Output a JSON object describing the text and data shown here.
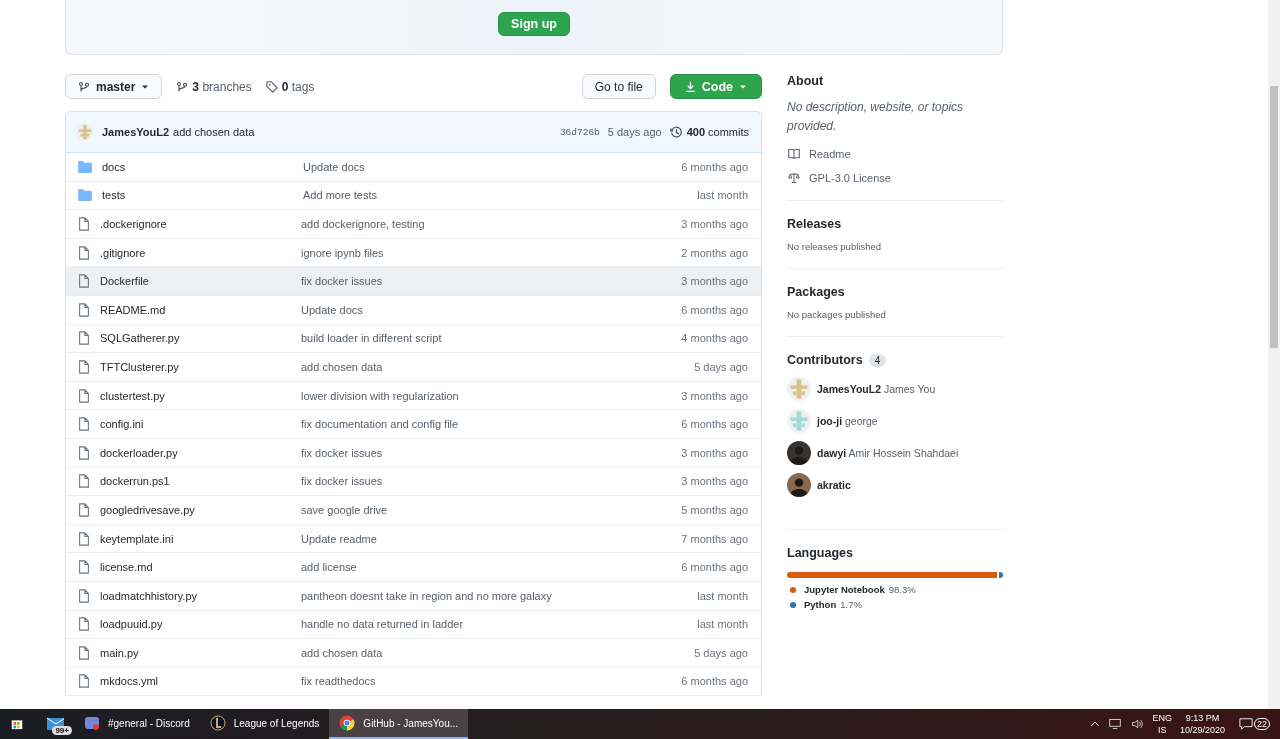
{
  "banner": {
    "button": "Sign up"
  },
  "branch_bar": {
    "branch": "master",
    "branches": "**3** branches",
    "tags": "**0** tags",
    "go_to_file": "Go to file",
    "code_button": "Code"
  },
  "latest_commit": {
    "author": "JamesYouL2",
    "message": "add chosen data",
    "sha": "36d726b",
    "time": "5 days ago",
    "commits": "**400** commits",
    "avatar": {
      "kind": "identicon",
      "color": "#d8c48a"
    }
  },
  "files": [
    {
      "kind": "folder",
      "name": "docs",
      "message": "Update docs",
      "age": "6 months ago",
      "highlighted": false
    },
    {
      "kind": "folder",
      "name": "tests",
      "message": "Add more tests",
      "age": "last month",
      "highlighted": false
    },
    {
      "kind": "file",
      "name": ".dockerignore",
      "message": "add dockerignore, testing",
      "age": "3 months ago",
      "highlighted": false
    },
    {
      "kind": "file",
      "name": ".gitignore",
      "message": "ignore ipynb files",
      "age": "2 months ago",
      "highlighted": false
    },
    {
      "kind": "file",
      "name": "Dockerfile",
      "message": "fix docker issues",
      "age": "3 months ago",
      "highlighted": true
    },
    {
      "kind": "file",
      "name": "README.md",
      "message": "Update docs",
      "age": "6 months ago",
      "highlighted": false
    },
    {
      "kind": "file",
      "name": "SQLGatherer.py",
      "message": "build loader in different script",
      "age": "4 months ago",
      "highlighted": false
    },
    {
      "kind": "file",
      "name": "TFTClusterer.py",
      "message": "add chosen data",
      "age": "5 days ago",
      "highlighted": false
    },
    {
      "kind": "file",
      "name": "clustertest.py",
      "message": "lower division with regularization",
      "age": "3 months ago",
      "highlighted": false
    },
    {
      "kind": "file",
      "name": "config.ini",
      "message": "fix documentation and config file",
      "age": "6 months ago",
      "highlighted": false
    },
    {
      "kind": "file",
      "name": "dockerloader.py",
      "message": "fix docker issues",
      "age": "3 months ago",
      "highlighted": false
    },
    {
      "kind": "file",
      "name": "dockerrun.ps1",
      "message": "fix docker issues",
      "age": "3 months ago",
      "highlighted": false
    },
    {
      "kind": "file",
      "name": "googledrivesave.py",
      "message": "save google drive",
      "age": "5 months ago",
      "highlighted": false
    },
    {
      "kind": "file",
      "name": "keytemplate.ini",
      "message": "Update readme",
      "age": "7 months ago",
      "highlighted": false
    },
    {
      "kind": "file",
      "name": "license.md",
      "message": "add license",
      "age": "6 months ago",
      "highlighted": false
    },
    {
      "kind": "file",
      "name": "loadmatchhistory.py",
      "message": "pantheon doesnt take in region and no more galaxy",
      "age": "last month",
      "highlighted": false
    },
    {
      "kind": "file",
      "name": "loadpuuid.py",
      "message": "handle no data returned in ladder",
      "age": "last month",
      "highlighted": false
    },
    {
      "kind": "file",
      "name": "main.py",
      "message": "add chosen data",
      "age": "5 days ago",
      "highlighted": false
    },
    {
      "kind": "file",
      "name": "mkdocs.yml",
      "message": "fix readthedocs",
      "age": "6 months ago",
      "highlighted": false
    }
  ],
  "about": {
    "title": "About",
    "description": "No description, website, or topics provided.",
    "links": [
      {
        "kind": "book",
        "label": "Readme"
      },
      {
        "kind": "scale",
        "label": "GPL-3.0 License"
      }
    ]
  },
  "releases": {
    "title": "Releases",
    "note": "No releases published"
  },
  "packages": {
    "title": "Packages",
    "note": "No packages published"
  },
  "contributors": {
    "title": "Contributors",
    "count": "4",
    "people": [
      {
        "text": "**JamesYouL2** James You",
        "avatar": {
          "kind": "identicon",
          "color": "#d8c48a"
        }
      },
      {
        "text": "**joo-ji** george",
        "avatar": {
          "kind": "identicon",
          "color": "#9fdcd8"
        }
      },
      {
        "text": "**dawyi** Amir Hossein Shahdaei",
        "avatar": {
          "kind": "photo",
          "color": "#3a3430"
        }
      },
      {
        "text": "**akratic**",
        "avatar": {
          "kind": "photo",
          "color": "#8a6a4e"
        }
      }
    ]
  },
  "languages": {
    "title": "Languages",
    "items": [
      {
        "name": "Jupyter Notebook",
        "percent": "98.3%",
        "color": "#da5b0b",
        "level": 0.983
      },
      {
        "name": "Python",
        "percent": "1.7%",
        "color": "#3572a5",
        "level": 0.017
      }
    ]
  },
  "taskbar": {
    "apps": [
      {
        "kind": "store",
        "active": false
      },
      {
        "kind": "mail",
        "badge": "99+",
        "active": false
      },
      {
        "kind": "discord",
        "label": "#general - Discord",
        "active": false
      },
      {
        "kind": "league",
        "label": "League of Legends",
        "active": false
      },
      {
        "kind": "chrome",
        "label": "GitHub - JamesYou...",
        "active": true
      }
    ],
    "lang": "ENG",
    "layout": "IS",
    "time": "9:13 PM",
    "date": "10/29/2020",
    "notifications": "22"
  }
}
